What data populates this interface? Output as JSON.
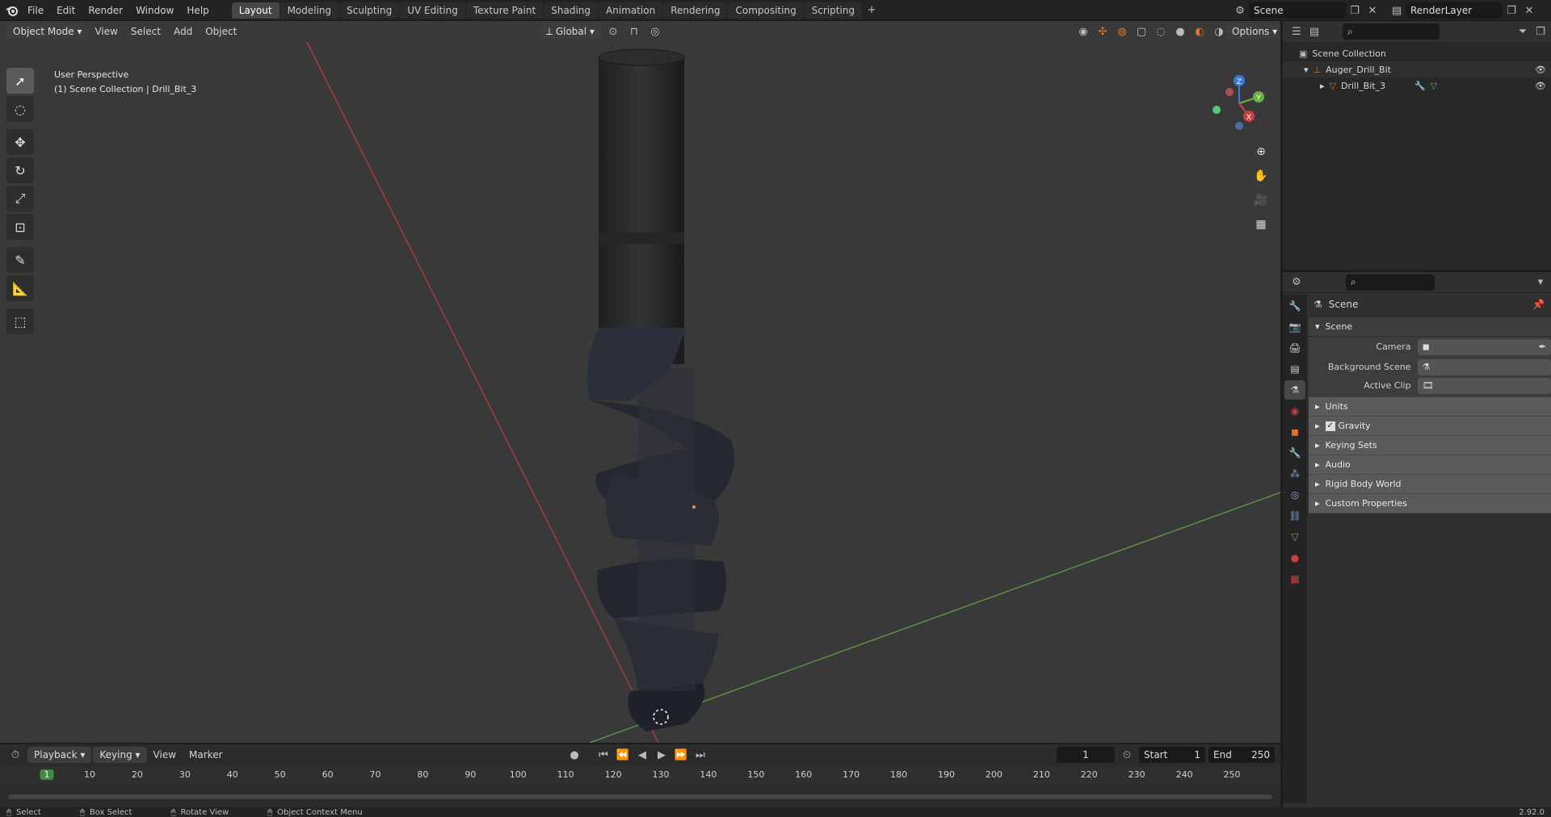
{
  "topbar": {
    "menus": [
      "File",
      "Edit",
      "Render",
      "Window",
      "Help"
    ],
    "workspaces": [
      "Layout",
      "Modeling",
      "Sculpting",
      "UV Editing",
      "Texture Paint",
      "Shading",
      "Animation",
      "Rendering",
      "Compositing",
      "Scripting"
    ],
    "active_workspace": "Layout",
    "scene_name": "Scene",
    "render_layer": "RenderLayer",
    "add_tab_glyph": "+"
  },
  "viewport_header": {
    "mode": "Object Mode",
    "menus": [
      "View",
      "Select",
      "Add",
      "Object"
    ],
    "transform_orientation": "Global",
    "options_label": "Options"
  },
  "viewport": {
    "perspective_label": "User Perspective",
    "collection_label": "(1) Scene Collection | Drill_Bit_3",
    "gizmo_axes": [
      "Z",
      "Y",
      "X"
    ]
  },
  "outliner": {
    "root": "Scene Collection",
    "items": [
      {
        "name": "Auger_Drill_Bit",
        "icon": "empty-icon"
      },
      {
        "name": "Drill_Bit_3",
        "icon": "mesh-icon"
      }
    ]
  },
  "properties": {
    "context_title": "Scene",
    "panel_title": "Scene",
    "fields": [
      {
        "label": "Camera",
        "value": ""
      },
      {
        "label": "Background Scene",
        "value": ""
      },
      {
        "label": "Active Clip",
        "value": ""
      }
    ],
    "subpanels": [
      "Units",
      "Gravity",
      "Keying Sets",
      "Audio",
      "Rigid Body World",
      "Custom Properties"
    ]
  },
  "timeline": {
    "menus": [
      "Playback",
      "Keying",
      "View",
      "Marker"
    ],
    "current_frame": "1",
    "start_label": "Start",
    "start_value": "1",
    "end_label": "End",
    "end_value": "250",
    "ruler_ticks": [
      "1",
      "10",
      "20",
      "30",
      "40",
      "50",
      "60",
      "70",
      "80",
      "90",
      "100",
      "110",
      "120",
      "130",
      "140",
      "150",
      "160",
      "170",
      "180",
      "190",
      "200",
      "210",
      "220",
      "230",
      "240",
      "250"
    ]
  },
  "statusbar": {
    "items": [
      "Select",
      "Box Select",
      "Rotate View",
      "Object Context Menu"
    ],
    "version": "2.92.0"
  },
  "colors": {
    "accent": "#e0732b",
    "active_frame": "#3d8c40",
    "x_axis": "#c94040",
    "y_axis": "#6ab043",
    "z_axis": "#3d78d8"
  }
}
